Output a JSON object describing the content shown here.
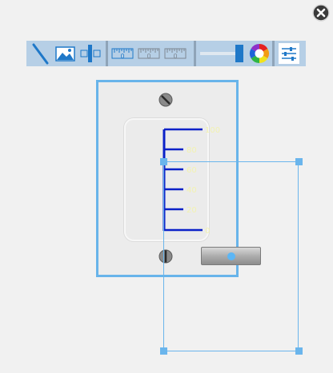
{
  "close_icon": "close-circle-icon",
  "toolbar": {
    "buttons": [
      {
        "name": "needle-tool-icon"
      },
      {
        "name": "image-tool-icon"
      },
      {
        "name": "bar-tool-icon"
      },
      {
        "name": "ruler-scale-1-icon"
      },
      {
        "name": "ruler-scale-2-icon"
      },
      {
        "name": "ruler-scale-3-icon"
      },
      {
        "name": "slider-tool-icon"
      },
      {
        "name": "color-wheel-icon"
      },
      {
        "name": "settings-sliders-icon"
      }
    ],
    "ruler_labels": [
      "0",
      "0",
      "0"
    ]
  },
  "gauge": {
    "ticks": [
      "100",
      "80",
      "60",
      "40",
      "20",
      "0"
    ],
    "tick_color": "#0b21c8",
    "label_color": "#f2f2b0"
  },
  "colors": {
    "accent": "#68b4ea",
    "toolbar_bg": "#b6cfe6",
    "icon_blue": "#1f78c8"
  }
}
